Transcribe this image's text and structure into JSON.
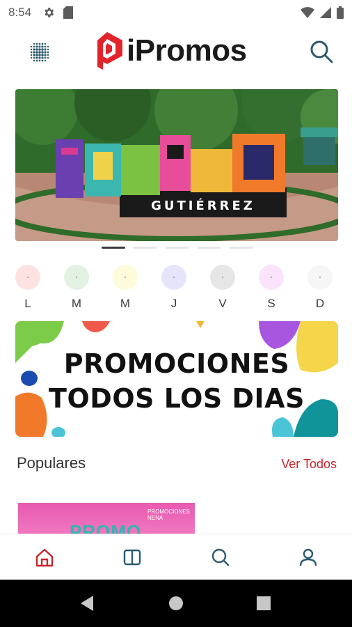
{
  "status_bar": {
    "time": "8:54",
    "icons_left": [
      "gear-icon",
      "sd-card-icon"
    ],
    "icons_right": [
      "wifi-icon",
      "signal-icon",
      "battery-icon"
    ]
  },
  "header": {
    "menu_icon": "grid-dots-icon",
    "logo_text": "iPromos",
    "logo_color": "#e3242b",
    "search_icon": "search-icon"
  },
  "hero": {
    "sign_text": "GUTIÉRREZ",
    "carousel_total": 5,
    "carousel_active": 1
  },
  "days": [
    {
      "label": "L",
      "color": "#fde2e2"
    },
    {
      "label": "M",
      "color": "#e3f1e3"
    },
    {
      "label": "M",
      "color": "#fdfbd9"
    },
    {
      "label": "J",
      "color": "#e6e4fb"
    },
    {
      "label": "V",
      "color": "#e6e6e6"
    },
    {
      "label": "S",
      "color": "#fbe3fb"
    },
    {
      "label": "D",
      "color": "#f6f6f6"
    }
  ],
  "promo_banner": {
    "line1": "PROMOCIONES",
    "line2": "TODOS LOS DIAS"
  },
  "populares": {
    "title": "Populares",
    "see_all": "Ver Todos",
    "accent_color": "#c9262b"
  },
  "card": {
    "text": "PROMO",
    "badge_line1": "PROMOCIONES",
    "badge_line2": "NENA"
  },
  "bottom_nav": {
    "items": [
      "home-icon",
      "catalog-icon",
      "search-icon",
      "profile-icon"
    ],
    "active_color": "#c9262b",
    "inactive_color": "#2b5a6e"
  }
}
